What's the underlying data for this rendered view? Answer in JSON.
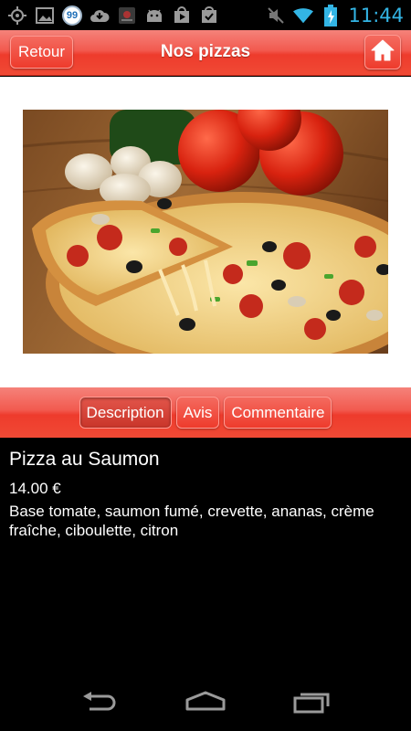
{
  "status_bar": {
    "time": "11:44",
    "badge_count": "99",
    "icons": [
      "gps-icon",
      "image-icon",
      "badge-99-icon",
      "cloud-download-icon",
      "app-icon",
      "android-icon",
      "play-store-icon",
      "checklist-icon",
      "mute-icon",
      "wifi-icon",
      "battery-charging-icon"
    ]
  },
  "header": {
    "back_label": "Retour",
    "title": "Nos pizzas",
    "home_icon": "home-icon",
    "accent_color": "#ee3b2c"
  },
  "tabs": [
    {
      "label": "Description",
      "active": true
    },
    {
      "label": "Avis",
      "active": false
    },
    {
      "label": "Commentaire",
      "active": false
    }
  ],
  "product": {
    "name": "Pizza au Saumon",
    "price": "14.00 €",
    "description": "Base tomate, saumon fumé, crevette, ananas, crème fraîche, ciboulette, citron"
  },
  "nav_bar": {
    "icons": [
      "back-icon",
      "home-nav-icon",
      "recent-apps-icon"
    ]
  }
}
